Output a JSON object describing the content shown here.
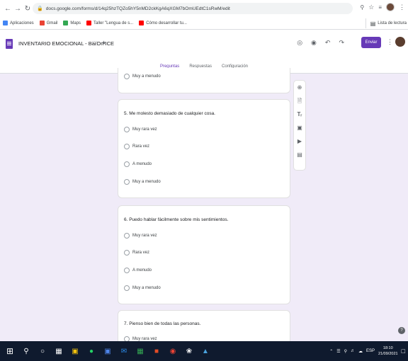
{
  "browser": {
    "url": "docs.google.com/forms/d/14q25hzTQZo5hY5nMD2ckKgA6qXGM7bOmUEdtC1sRwM/edit",
    "bookmarks": [
      {
        "label": "Aplicaciones",
        "color": "#4285f4"
      },
      {
        "label": "Gmail",
        "color": "#ea4335"
      },
      {
        "label": "Maps",
        "color": "#34a853"
      },
      {
        "label": "Taller \"Lengua de s...",
        "color": "#ff0000"
      },
      {
        "label": "Cómo desarrollar tu...",
        "color": "#ff0000"
      }
    ],
    "reading_list": "Lista de lectura"
  },
  "forms": {
    "title": "INVENTARIO EMOCIONAL - BarOn ICE",
    "send_label": "Enviar",
    "accent": "#673ab7",
    "tabs": [
      "Preguntas",
      "Respuestas",
      "Configuración"
    ]
  },
  "questions": [
    {
      "title": "",
      "options": [
        "Muy a menudo"
      ]
    },
    {
      "title": "5. Me molesto demasiado de cualquier cosa.",
      "options": [
        "Muy rara vez",
        "Rara vez",
        "A menudo",
        "Muy a menudo"
      ]
    },
    {
      "title": "6. Puedo hablar fácilmente sobre mis sentimientos.",
      "options": [
        "Muy rara vez",
        "Rara vez",
        "A menudo",
        "Muy a menudo"
      ]
    },
    {
      "title": "7. Pienso bien de todas las personas.",
      "options": [
        "Muy rara vez"
      ]
    }
  ],
  "tray": {
    "lang": "ESP",
    "time": "18:10",
    "date": "21/09/2021"
  }
}
